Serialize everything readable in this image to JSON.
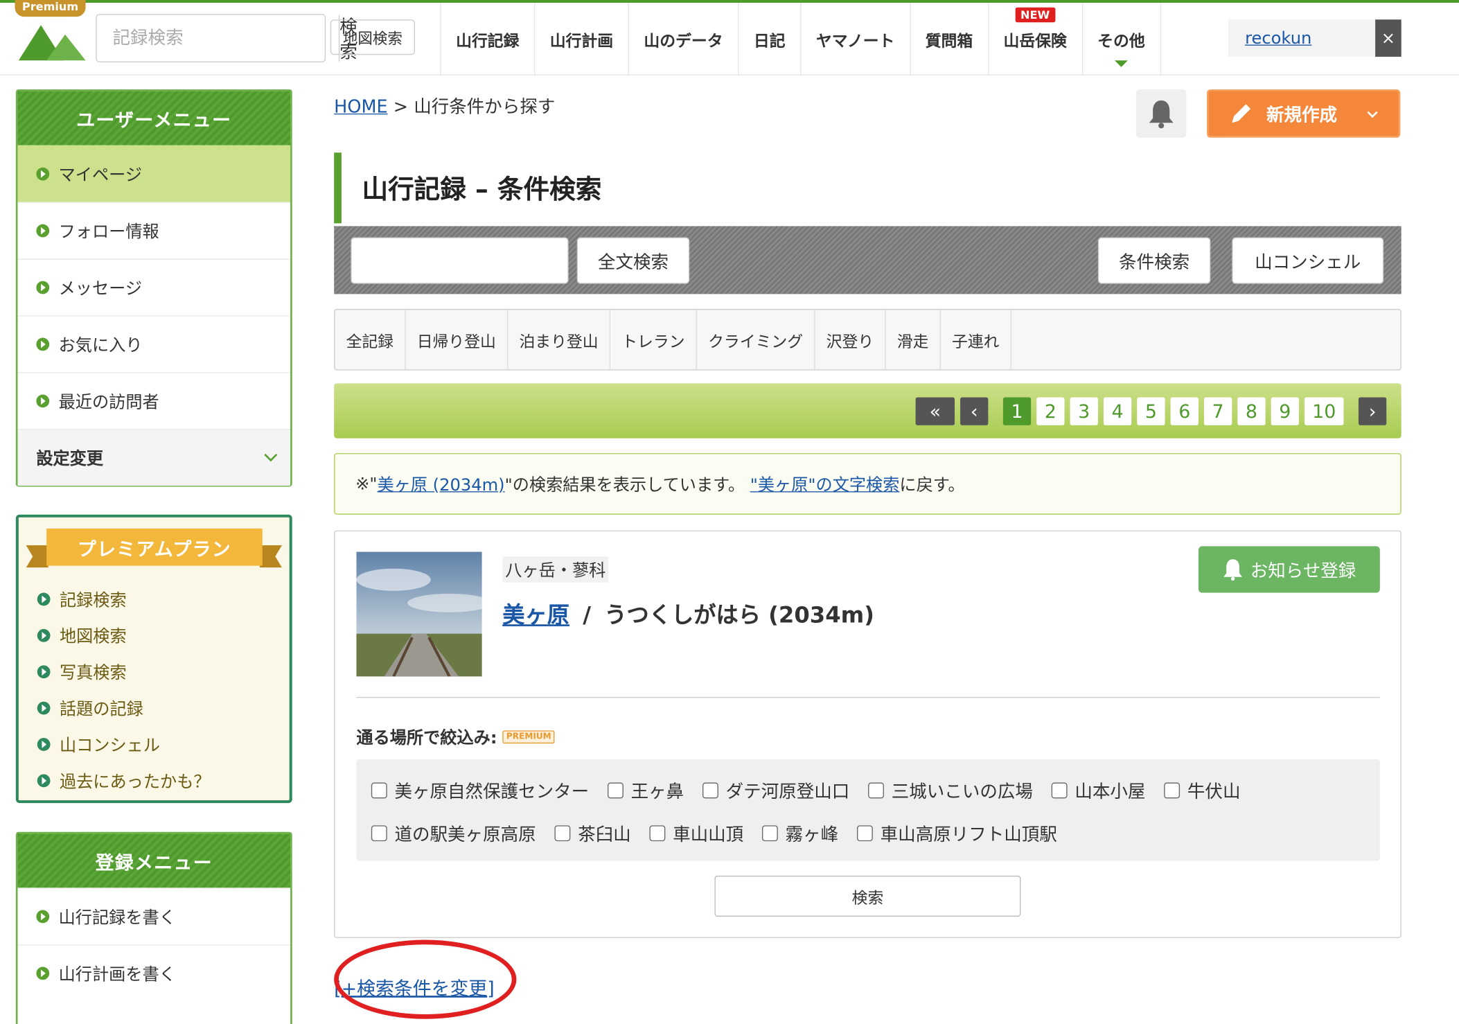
{
  "header": {
    "premium_tag": "Premium",
    "search_placeholder": "記録検索",
    "search_button": "検索",
    "map_search_button": "地図検索",
    "nav": [
      {
        "label": "山行記録"
      },
      {
        "label": "山行計画"
      },
      {
        "label": "山のデータ"
      },
      {
        "label": "日記"
      },
      {
        "label": "ヤマノート"
      },
      {
        "label": "質問箱"
      },
      {
        "label": "山岳保険",
        "badge": "NEW"
      },
      {
        "label": "その他"
      }
    ],
    "username": "recokun",
    "close_symbol": "×"
  },
  "sidebar": {
    "user_menu_title": "ユーザーメニュー",
    "user_menu": [
      "マイページ",
      "フォロー情報",
      "メッセージ",
      "お気に入り",
      "最近の訪問者"
    ],
    "settings_label": "設定変更",
    "premium_title": "プレミアムプラン",
    "premium_links": [
      "記録検索",
      "地図検索",
      "写真検索",
      "話題の記録",
      "山コンシェル",
      "過去にあったかも？"
    ],
    "register_title": "登録メニュー",
    "register_menu": [
      "山行記録を書く",
      "山行計画を書く"
    ]
  },
  "breadcrumb": {
    "home": "HOME",
    "separator": ">",
    "current": "山行条件から探す"
  },
  "new_button": "新規作成",
  "page_title": "山行記録 – 条件検索",
  "search_bar": {
    "fulltext_value": "",
    "fulltext_button": "全文検索",
    "condition_button": "条件検索",
    "concierge_button": "山コンシェル"
  },
  "category_tabs": [
    "全記録",
    "日帰り登山",
    "泊まり登山",
    "トレラン",
    "クライミング",
    "沢登り",
    "滑走",
    "子連れ"
  ],
  "pagination": {
    "first": "«",
    "prev": "‹",
    "pages": [
      "1",
      "2",
      "3",
      "4",
      "5",
      "6",
      "7",
      "8",
      "9",
      "10"
    ],
    "current": "1",
    "next": "›"
  },
  "notice": {
    "prefix": "※\"",
    "result_link": "美ヶ原 (2034m)",
    "middle": "\"の検索結果を表示しています。 ",
    "back_link": "\"美ヶ原\"の文字検索",
    "suffix": "に戻す。"
  },
  "result": {
    "area": "八ヶ岳・蓼科",
    "mountain_link": "美ヶ原",
    "slash": "/",
    "mountain_reading": "うつくしがはら (2034m)",
    "notify_button": "お知らせ登録",
    "filter_label": "通る場所で絞込み:",
    "premium_badge": "PREMIUM",
    "places_row1": [
      "美ヶ原自然保護センター",
      "王ヶ鼻",
      "ダテ河原登山口",
      "三城いこいの広場",
      "山本小屋",
      "牛伏山"
    ],
    "places_row2": [
      "道の駅美ヶ原高原",
      "茶臼山",
      "車山山頂",
      "霧ヶ峰",
      "車山高原リフト山頂駅"
    ],
    "search_button": "検索"
  },
  "change_condition": {
    "open": "[",
    "plus": "+",
    "link": "検索条件を変更",
    "close": "]"
  },
  "colors": {
    "brand_green": "#4e9a2a",
    "orange": "#f5873a",
    "link_blue": "#1a57a6",
    "annotation_red": "#e02020"
  }
}
